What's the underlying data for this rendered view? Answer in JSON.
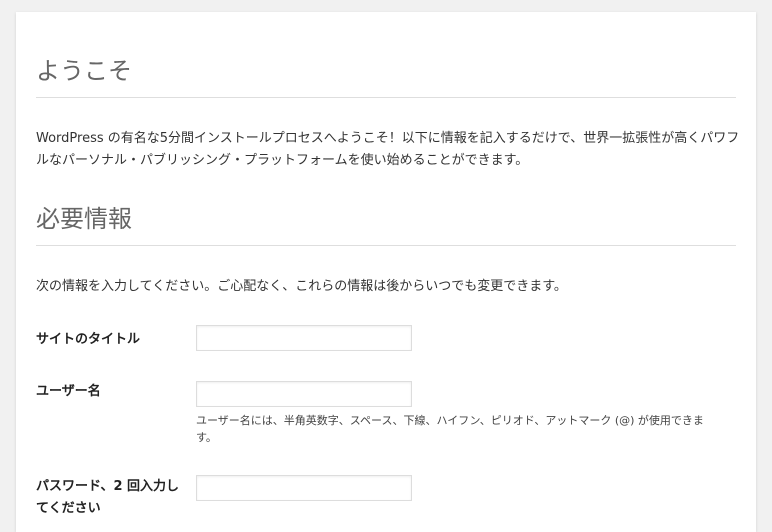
{
  "welcome": {
    "title": "ようこそ",
    "body": "WordPress の有名な5分間インストールプロセスへようこそ！以下に情報を記入するだけで、世界一拡張性が高くパワフルなパーソナル・パブリッシング・プラットフォームを使い始めることができます。"
  },
  "required": {
    "title": "必要情報",
    "intro": "次の情報を入力してください。ご心配なく、これらの情報は後からいつでも変更できます。"
  },
  "form": {
    "site_title": {
      "label": "サイトのタイトル",
      "value": ""
    },
    "username": {
      "label": "ユーザー名",
      "value": "",
      "hint": "ユーザー名には、半角英数字、スペース、下線、ハイフン、ピリオド、アットマーク (@) が使用できます。"
    },
    "password": {
      "label": "パスワード、2 回入力してください",
      "value": ""
    }
  }
}
